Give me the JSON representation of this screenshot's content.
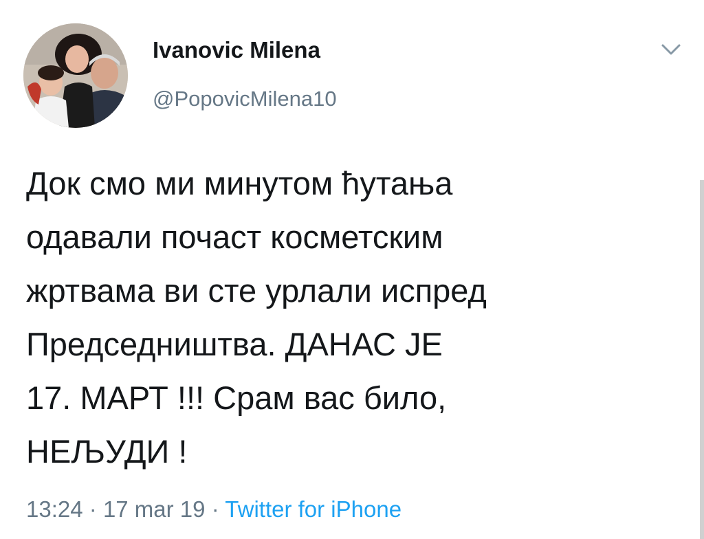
{
  "tweet": {
    "author": {
      "display_name": "Ivanovic Milena",
      "handle": "@PopovicMilena10"
    },
    "text": "Док смо ми минутом ћутања\nодавали почаст косметским\nжртвама ви сте урлали испред\nПредседништва. ДАНАС ЈЕ\n17. МАРТ !!! Срам вас било,\nНЕЉУДИ !",
    "time": "13:24",
    "date": "17 mar 19",
    "separator": "·",
    "source": "Twitter for iPhone"
  },
  "icons": {
    "menu": "chevron-down-icon"
  },
  "colors": {
    "text_primary": "#14171a",
    "text_secondary": "#657786",
    "link": "#1da1f2",
    "background": "#ffffff"
  }
}
